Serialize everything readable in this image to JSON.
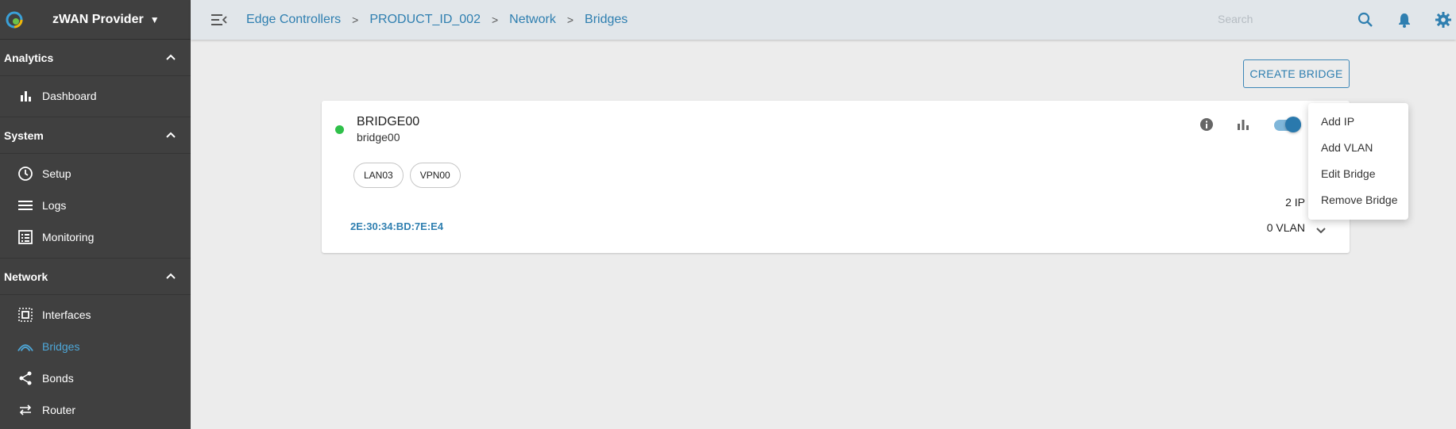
{
  "brand": {
    "name": "zWAN Provider"
  },
  "sidebar": {
    "sections": [
      {
        "label": "Analytics",
        "items": [
          {
            "label": "Dashboard",
            "icon": "bar-chart-icon"
          }
        ]
      },
      {
        "label": "System",
        "items": [
          {
            "label": "Setup",
            "icon": "clock-icon"
          },
          {
            "label": "Logs",
            "icon": "list-icon"
          },
          {
            "label": "Monitoring",
            "icon": "monitoring-icon"
          }
        ]
      },
      {
        "label": "Network",
        "items": [
          {
            "label": "Interfaces",
            "icon": "interfaces-icon"
          },
          {
            "label": "Bridges",
            "icon": "bridge-icon",
            "active": true
          },
          {
            "label": "Bonds",
            "icon": "share-icon"
          },
          {
            "label": "Router",
            "icon": "swap-icon"
          }
        ]
      }
    ]
  },
  "breadcrumb": [
    "Edge Controllers",
    "PRODUCT_ID_002",
    "Network",
    "Bridges"
  ],
  "search": {
    "placeholder": "Search"
  },
  "actions": {
    "create_label": "CREATE BRIDGE"
  },
  "bridge": {
    "title": "BRIDGE00",
    "subtitle": "bridge00",
    "members": [
      "LAN03",
      "VPN00"
    ],
    "mac": "2E:30:34:BD:7E:E4",
    "ip_count": "2 IP",
    "vlan_count": "0 VLAN",
    "enabled": true,
    "status_color": "#2fc04a"
  },
  "menu": {
    "items": [
      "Add IP",
      "Add VLAN",
      "Edit Bridge",
      "Remove Bridge"
    ]
  },
  "colors": {
    "accent": "#2f7fb0",
    "sidebar_bg": "#404040",
    "active_nav": "#4ea7d8"
  }
}
